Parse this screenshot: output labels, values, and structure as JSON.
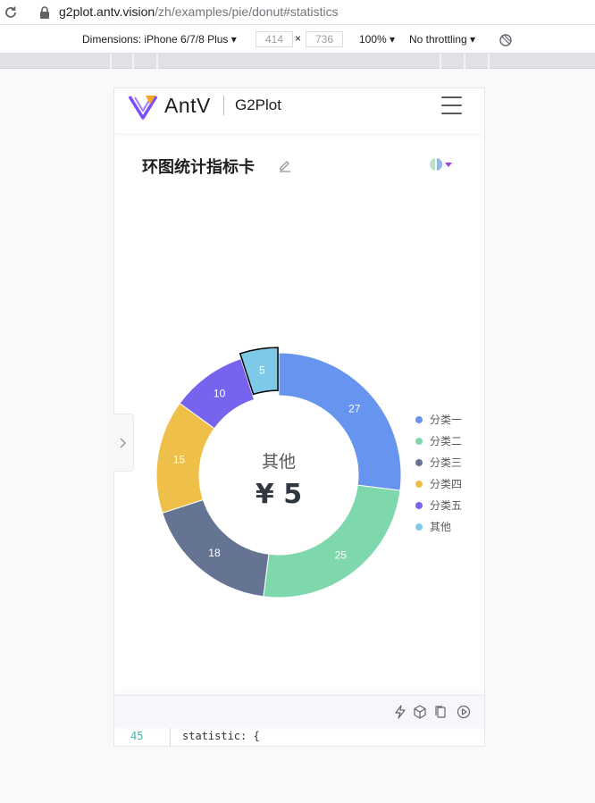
{
  "browser": {
    "url_host": "g2plot.antv.vision",
    "url_path": "/zh/examples/pie/donut#statistics",
    "icons": [
      "reload-icon",
      "lock-icon"
    ]
  },
  "devtools": {
    "dimensions_label": "Dimensions: iPhone 6/7/8 Plus ▾",
    "width_value": "414",
    "height_value": "736",
    "times": "×",
    "zoom_label": "100% ▾",
    "throttling_label": "No throttling ▾"
  },
  "site": {
    "brand": "AntV",
    "product": "G2Plot"
  },
  "demo": {
    "title": "环图统计指标卡"
  },
  "chart_data": {
    "type": "pie",
    "donut": true,
    "categories": [
      "分类一",
      "分类二",
      "分类三",
      "分类四",
      "分类五",
      "其他"
    ],
    "values": [
      27,
      25,
      18,
      15,
      10,
      5
    ],
    "colors": [
      "#6794ef",
      "#7ed8ac",
      "#657493",
      "#eebf49",
      "#7663ee",
      "#7ec9e8"
    ],
    "selected": "其他",
    "statistic_title": "其他",
    "statistic_value": "¥ 5",
    "legend_position": "right"
  },
  "code": {
    "line_number": "45",
    "line_text": "statistic: {"
  }
}
